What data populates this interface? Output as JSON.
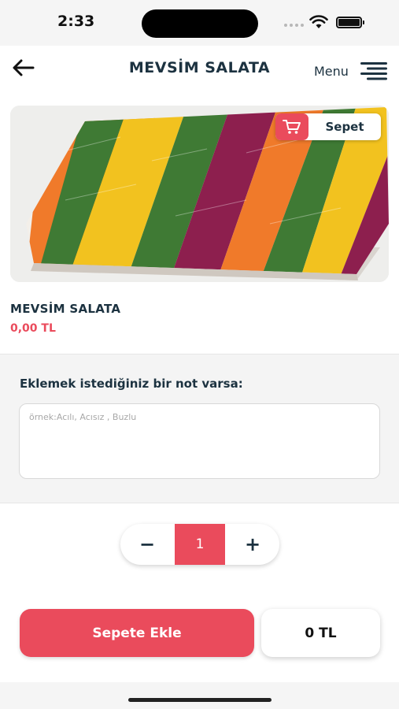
{
  "status_bar": {
    "time": "2:33"
  },
  "header": {
    "title": "MEVSİM SALATA",
    "menu_label": "Menu"
  },
  "cart_button": {
    "label": "Sepet"
  },
  "product": {
    "name": "MEVSİM SALATA",
    "price": "0,00 TL"
  },
  "note": {
    "label": "Eklemek istediğiniz bir not varsa:",
    "placeholder": "örnek:Acılı, Acısız , Buzlu",
    "value": ""
  },
  "quantity": {
    "minus": "−",
    "value": "1",
    "plus": "+"
  },
  "actions": {
    "add_to_cart": "Sepete Ekle",
    "total": "0 TL"
  },
  "colors": {
    "accent": "#ea4b5c",
    "text_dark": "#1c3240"
  }
}
